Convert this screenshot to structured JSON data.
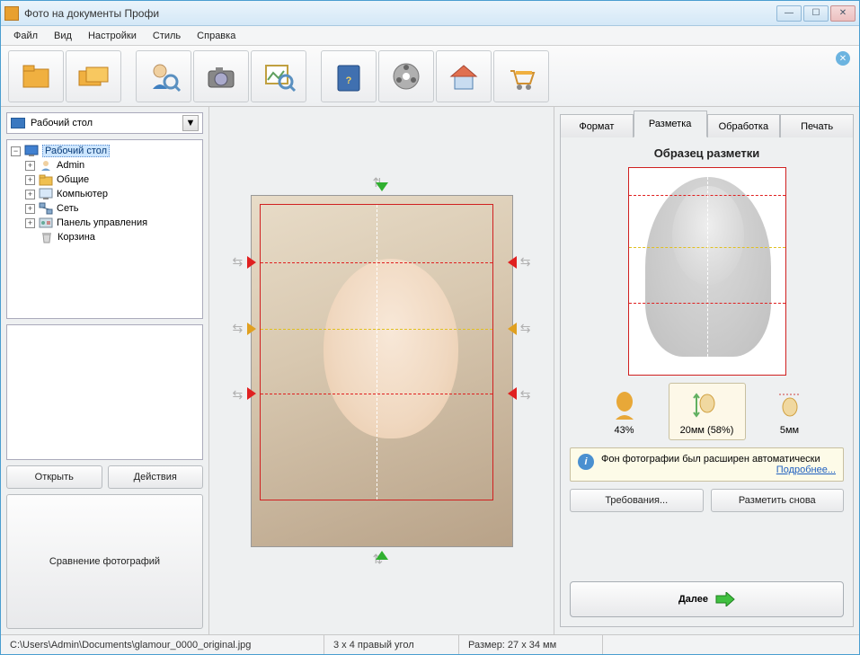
{
  "title": "Фото на документы Профи",
  "menu": [
    "Файл",
    "Вид",
    "Настройки",
    "Стиль",
    "Справка"
  ],
  "toolbar_icons": [
    "folder",
    "folder-multi",
    "person-search",
    "camera",
    "photo-search",
    "",
    "help-book",
    "film",
    "home",
    "cart"
  ],
  "left": {
    "combo": "Рабочий стол",
    "tree": [
      {
        "label": "Рабочий стол",
        "icon": "monitor",
        "sel": true,
        "exp": "-",
        "depth": 0
      },
      {
        "label": "Admin",
        "icon": "user",
        "exp": "+",
        "depth": 1
      },
      {
        "label": "Общие",
        "icon": "folder",
        "exp": "+",
        "depth": 1
      },
      {
        "label": "Компьютер",
        "icon": "computer",
        "exp": "+",
        "depth": 1
      },
      {
        "label": "Сеть",
        "icon": "network",
        "exp": "+",
        "depth": 1
      },
      {
        "label": "Панель управления",
        "icon": "panel",
        "exp": "+",
        "depth": 1
      },
      {
        "label": "Корзина",
        "icon": "trash",
        "exp": "",
        "depth": 1
      }
    ],
    "open_btn": "Открыть",
    "actions_btn": "Действия",
    "compare_btn": "Сравнение фотографий"
  },
  "tabs": [
    "Формат",
    "Разметка",
    "Обработка",
    "Печать"
  ],
  "active_tab": 1,
  "sample_title": "Образец разметки",
  "metrics": [
    {
      "label": "43%"
    },
    {
      "label": "20мм (58%)",
      "sel": true
    },
    {
      "label": "5мм"
    }
  ],
  "info_text": "Фон фотографии был расширен автоматически",
  "info_link": "Подробнее...",
  "req_btn": "Требования...",
  "remark_btn": "Разметить снова",
  "next_btn": "Далее",
  "status": {
    "path": "C:\\Users\\Admin\\Documents\\glamour_0000_original.jpg",
    "format": "3 x 4 правый угол",
    "size": "Размер: 27 x 34 мм"
  }
}
